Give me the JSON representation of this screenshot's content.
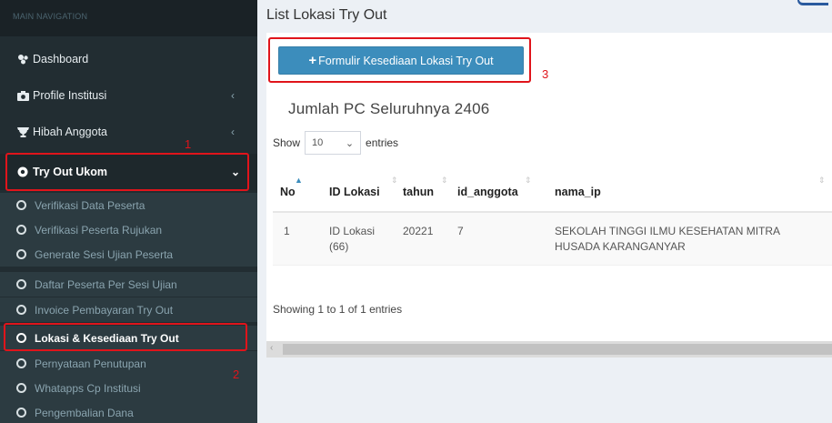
{
  "sidebar": {
    "header": "MAIN NAVIGATION",
    "items": [
      {
        "label": "Dashboard",
        "icon": "dashboard-icon"
      },
      {
        "label": "Profile Institusi",
        "icon": "camera-icon",
        "chevron": "‹"
      },
      {
        "label": "Hibah Anggota",
        "icon": "trophy-icon",
        "chevron": "‹"
      },
      {
        "label": "Try Out Ukom",
        "icon": "dot-circle-icon",
        "chevron": "⌄"
      }
    ],
    "submenu": [
      {
        "label": "Verifikasi Data Peserta"
      },
      {
        "label": "Verifikasi Peserta Rujukan"
      },
      {
        "label": "Generate Sesi Ujian Peserta"
      },
      {
        "label": "Daftar Peserta Per Sesi Ujian"
      },
      {
        "label": "Invoice Pembayaran Try Out"
      },
      {
        "label": "Lokasi & Kesediaan Try Out"
      },
      {
        "label": "Pernyataan Penutupan"
      },
      {
        "label": "Whatapps Cp Institusi"
      },
      {
        "label": "Pengembalian Dana"
      }
    ]
  },
  "annotations": {
    "n1": "1",
    "n2": "2",
    "n3": "3",
    "color": "#e0141b"
  },
  "main": {
    "title": "List Lokasi Try Out",
    "add_button": {
      "plus": "+",
      "label": "Formulir Kesediaan Lokasi Try Out"
    },
    "jumlah": "Jumlah PC Seluruhnya 2406",
    "show_label": "Show",
    "entries_value": "10",
    "entries_label": "entries",
    "columns": [
      "No",
      "ID Lokasi",
      "tahun",
      "id_anggota",
      "nama_ip"
    ],
    "rows": [
      {
        "no": "1",
        "id_lokasi": "ID Lokasi (66)",
        "tahun": "20221",
        "id_anggota": "7",
        "nama_ip": "SEKOLAH TINGGI ILMU KESEHATAN MITRA HUSADA KARANGANYAR"
      }
    ],
    "info": "Showing 1 to 1 of 1 entries"
  },
  "colors": {
    "sidebar_bg": "#222d32",
    "primary": "#3c8dbc",
    "page_bg": "#ecf0f5"
  }
}
